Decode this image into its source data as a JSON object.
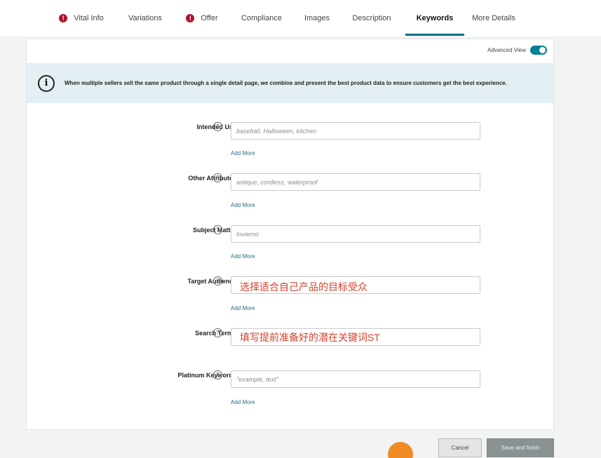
{
  "tabs": [
    {
      "label": "Vital Info",
      "error": true
    },
    {
      "label": "Variations",
      "error": false
    },
    {
      "label": "Offer",
      "error": true
    },
    {
      "label": "Compliance",
      "error": false
    },
    {
      "label": "Images",
      "error": false
    },
    {
      "label": "Description",
      "error": false
    },
    {
      "label": "Keywords",
      "error": false,
      "active": true
    },
    {
      "label": "More Details",
      "error": false
    }
  ],
  "error_icon_glyph": "!",
  "advanced_view": {
    "label": "Advanced View",
    "on": true
  },
  "banner": {
    "icon_glyph": "i",
    "text": "When multiple sellers sell the same product through a single detail page, we combine and present the best product data to ensure customers get the best experience."
  },
  "help_glyph": "?",
  "add_more_label": "Add More",
  "fields": {
    "intended_use": {
      "label": "Intended Use",
      "placeholder": "baseball, Halloween, kitchen",
      "value": ""
    },
    "other_attributes": {
      "label": "Other Attributes",
      "placeholder": "antique, cordless, waterproof",
      "value": ""
    },
    "subject_matter": {
      "label": "Subject Matter",
      "placeholder": "Invierno",
      "value": ""
    },
    "target_audience": {
      "label": "Target Audience",
      "placeholder": "",
      "value": "",
      "annotation": "选择适合自己产品的目标受众"
    },
    "search_terms": {
      "label": "Search Terms",
      "placeholder": "",
      "value": "",
      "annotation": "填写提前准备好的潜在关键词ST"
    },
    "platinum_keywords": {
      "label": "Platinum Keywords",
      "placeholder": "\"example_text\"",
      "value": ""
    }
  },
  "buttons": {
    "cancel": "Cancel",
    "save": "Save and finish"
  },
  "colors": {
    "accent": "#007185",
    "toggle": "#008296",
    "error": "#b3132b",
    "annotation": "#d6402c",
    "banner_bg": "#e4eff3"
  }
}
